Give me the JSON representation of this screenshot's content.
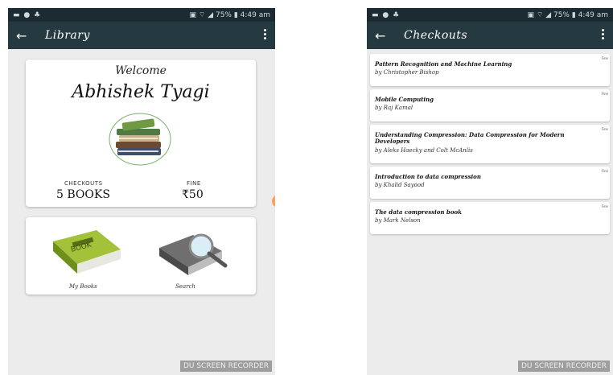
{
  "left": {
    "status": {
      "left": "▬ ● ♣",
      "right": "▣ ⌔ ◢ 75% ▮ 4:49 am"
    },
    "appbar": {
      "title": "Library"
    },
    "welcome": {
      "label": "Welcome",
      "name": "Abhishek Tyagi",
      "checkouts_label": "CHECKOUTS",
      "checkouts_value": "5 BOOKS",
      "fine_label": "FINE",
      "fine_value": "₹50"
    },
    "actions": [
      {
        "label": "My Books"
      },
      {
        "label": "Search"
      }
    ],
    "watermark": "DU SCREEN RECORDER"
  },
  "right": {
    "status": {
      "left": "▬ ● ♣",
      "right": "▣ ⌔ ◢ 75% ▮ 4:49 am"
    },
    "appbar": {
      "title": "Checkouts"
    },
    "items": [
      {
        "title": "Pattern Recognition and Machine Learning",
        "author": "by Christopher Bishop",
        "fine": "Fine"
      },
      {
        "title": "Mobile Computing",
        "author": "by Raj Kamal",
        "fine": "Fine"
      },
      {
        "title": "Understanding Compression: Data Compression for Modern Developers",
        "author": "by Aleks Haecky and Colt McAnlis",
        "fine": "Fine"
      },
      {
        "title": "Introduction to data compression",
        "author": "by Khalid Sayood",
        "fine": "Fine"
      },
      {
        "title": "The data compression book",
        "author": "by Mark Nelson",
        "fine": "Fine"
      }
    ],
    "watermark": "DU SCREEN RECORDER"
  },
  "colors": {
    "appbar": "#253a40",
    "statusbar": "#1c2b31",
    "background": "#ececec"
  }
}
